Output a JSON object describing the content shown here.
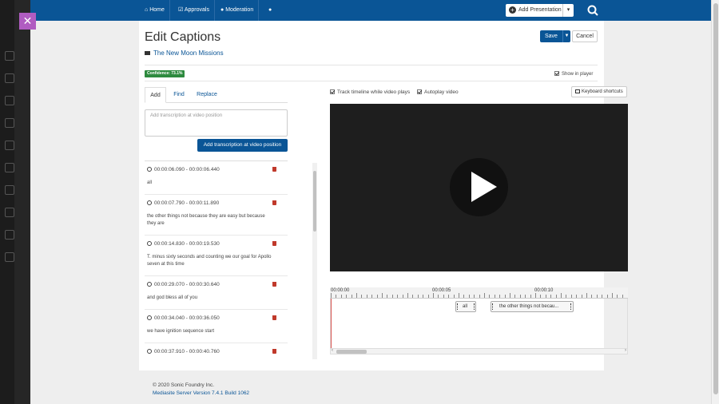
{
  "nav": {
    "home": "Home",
    "approvals": "Approvals",
    "moderation": "Moderation",
    "add_presentation": "Add Presentation"
  },
  "page": {
    "title": "Edit Captions",
    "presentation": "The New Moon Missions",
    "save": "Save",
    "cancel": "Cancel",
    "confidence": "Confidence: 73.1%",
    "show_in_player": "Show in player"
  },
  "tabs": [
    "Add",
    "Find",
    "Replace"
  ],
  "transcription": {
    "placeholder": "Add transcription at video position",
    "button": "Add transcription at video position"
  },
  "captions": [
    {
      "time": "00:00:06.090 - 00:00:06.440",
      "text": "all"
    },
    {
      "time": "00:00:07.790 - 00:00:11.890",
      "text": "the other things not because they are easy but because they are"
    },
    {
      "time": "00:00:14.830 - 00:00:19.530",
      "text": "T. minus sixty seconds and counting we our goal for Apollo seven at this time"
    },
    {
      "time": "00:00:29.070 - 00:00:30.640",
      "text": "and god bless all of you"
    },
    {
      "time": "00:00:34.040 - 00:00:36.050",
      "text": "we have ignition sequence start"
    },
    {
      "time": "00:00:37.910 - 00:00:40.760",
      "text": ""
    }
  ],
  "options": {
    "track_timeline": "Track timeline while video plays",
    "autoplay": "Autoplay video",
    "keyboard_shortcuts": "Keyboard shortcuts"
  },
  "timeline": {
    "labels": [
      "00:00:00",
      "00:00:05",
      "00:00:10"
    ],
    "segments": [
      "all",
      "the other things not becau..."
    ]
  },
  "footer": {
    "copyright": "© 2020 Sonic Foundry Inc.",
    "version": "Mediasite Server Version 7.4.1 Build 1062"
  },
  "colors": {
    "nav": "#0a5596",
    "confidence": "#2d8a3e",
    "close": "#b05cc1"
  }
}
